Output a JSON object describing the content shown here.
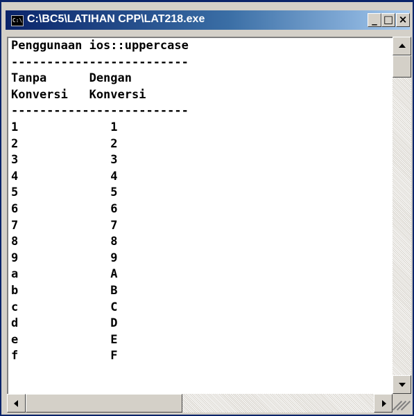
{
  "window": {
    "title": "C:\\BC5\\LATIHAN CPP\\LAT218.exe",
    "app_icon": "console-app-icon",
    "minimize_label": "_",
    "maximize_label": "□",
    "close_label": "×"
  },
  "console": {
    "lines": [
      "Penggunaan ios::uppercase",
      "-------------------------",
      "Tanpa      Dengan",
      "Konversi   Konversi",
      "-------------------------",
      "1             1",
      "2             2",
      "3             3",
      "4             4",
      "5             5",
      "6             6",
      "7             7",
      "8             8",
      "9             9",
      "a             A",
      "b             B",
      "c             C",
      "d             D",
      "e             E",
      "f             F"
    ]
  },
  "colors": {
    "title_bar_start": "#0a246a",
    "title_bar_end": "#a6caf0",
    "console_background": "#ffffff",
    "console_text": "#000000",
    "window_chrome": "#d4d0c8"
  }
}
